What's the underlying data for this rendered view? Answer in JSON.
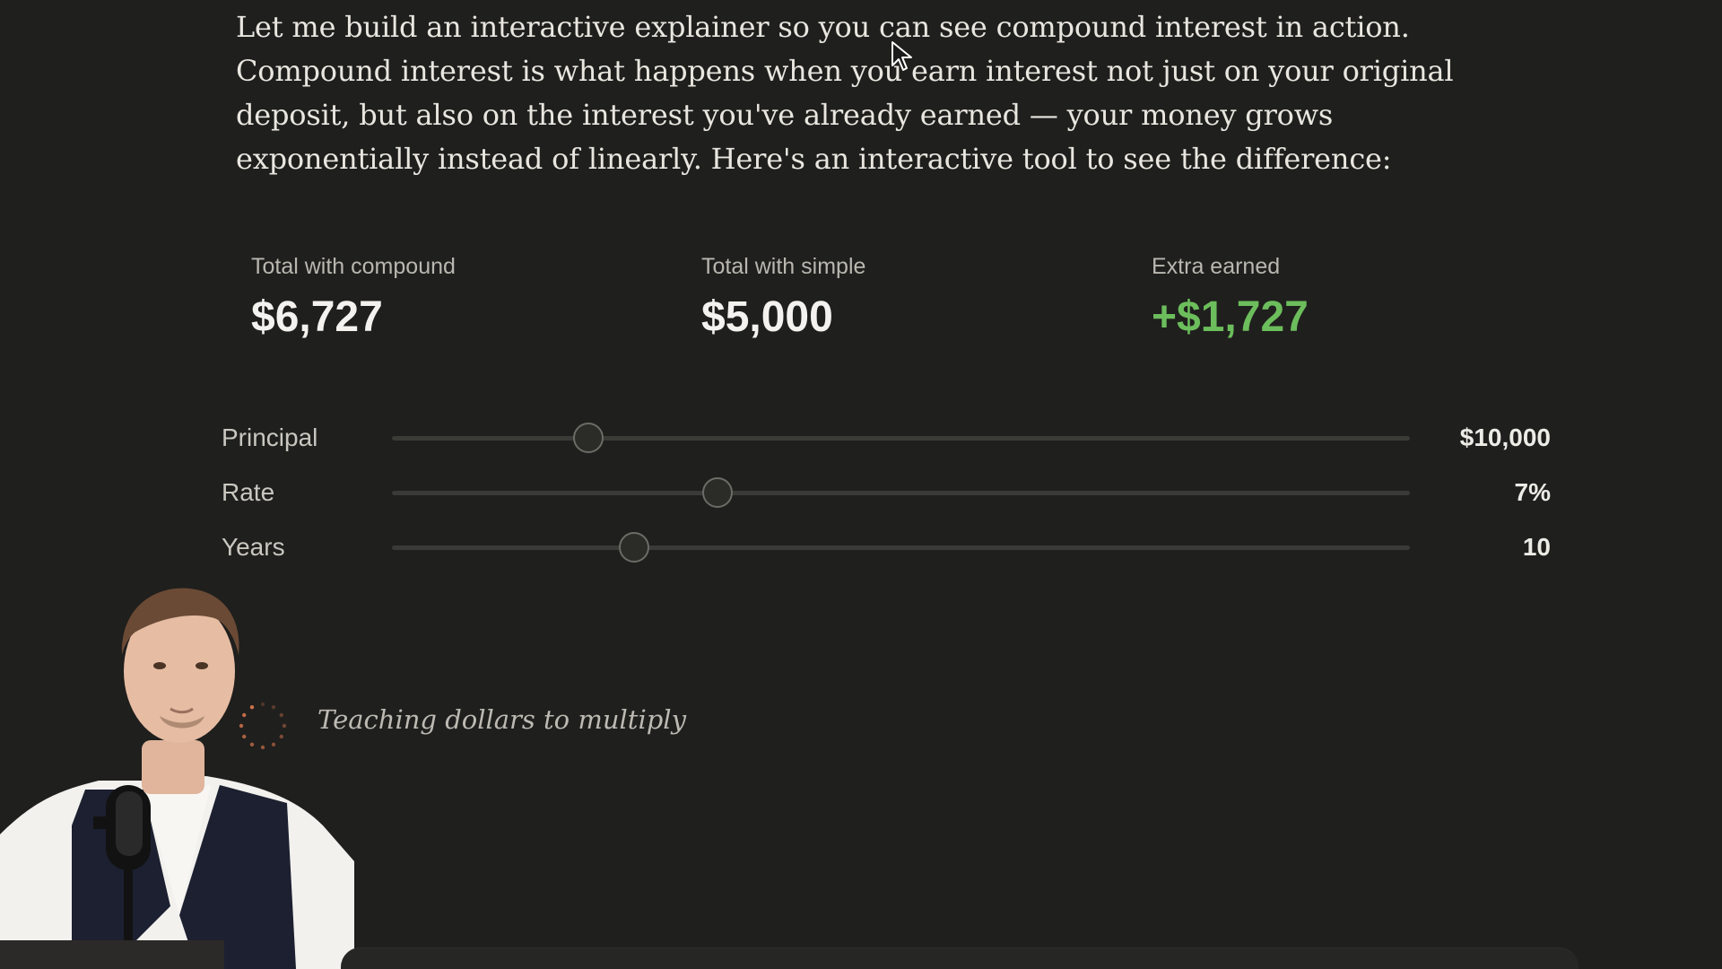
{
  "intro": {
    "text": "Let me build an interactive explainer so you can see compound interest in action. Compound interest is what happens when you earn interest not just on your original deposit, but also on the interest you've already earned — your money grows exponentially instead of linearly. Here's an interactive tool to see the difference:"
  },
  "stats": {
    "compound": {
      "label": "Total with compound",
      "value": "$6,727"
    },
    "simple": {
      "label": "Total with simple",
      "value": "$5,000"
    },
    "extra": {
      "label": "Extra earned",
      "value": "+$1,727"
    }
  },
  "controls": {
    "principal": {
      "label": "Principal",
      "value": "$10,000",
      "fraction": 0.193
    },
    "rate": {
      "label": "Rate",
      "value": "7%",
      "fraction": 0.32
    },
    "years": {
      "label": "Years",
      "value": "10",
      "fraction": 0.238
    }
  },
  "status": {
    "tagline": "Teaching dollars to multiply"
  },
  "colors": {
    "background": "#1f1f1d",
    "accent_positive": "#6cbd5c",
    "spinner": "#d9784f"
  },
  "icons": {
    "spinner": "loading-spinner-icon",
    "cursor": "mouse-pointer-icon"
  }
}
